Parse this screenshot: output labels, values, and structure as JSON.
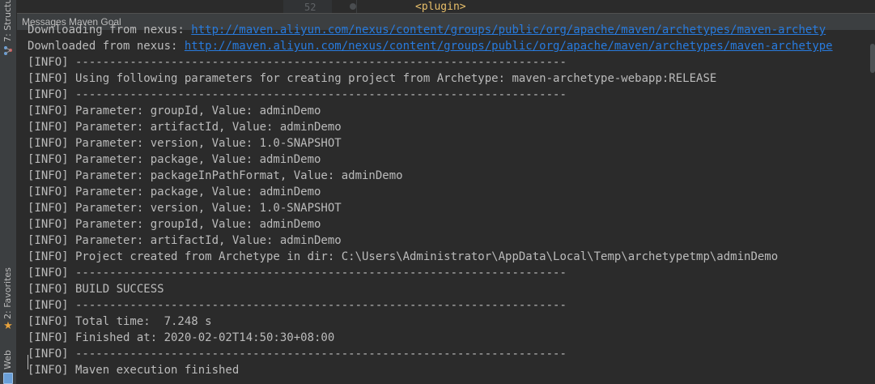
{
  "tool_stripe": {
    "structure_label": "7: Structure",
    "structure_icon": "structure-icon",
    "favorites_label": "2: Favorites",
    "favorites_icon": "star-icon",
    "web_label": "Web",
    "web_icon": "web-icon"
  },
  "editor": {
    "line_number": "52",
    "visible_code": "<plugin>"
  },
  "panel": {
    "title": "Messages Maven Goal"
  },
  "console": {
    "lines": [
      {
        "prefix": "Downloading from nexus: ",
        "link": "http://maven.aliyun.com/nexus/content/groups/public/org/apache/maven/archetypes/maven-archety"
      },
      {
        "prefix": "Downloaded from nexus: ",
        "link": "http://maven.aliyun.com/nexus/content/groups/public/org/apache/maven/archetypes/maven-archetype"
      },
      {
        "text": "[INFO] ------------------------------------------------------------------------"
      },
      {
        "text": "[INFO] Using following parameters for creating project from Archetype: maven-archetype-webapp:RELEASE"
      },
      {
        "text": "[INFO] ------------------------------------------------------------------------"
      },
      {
        "text": "[INFO] Parameter: groupId, Value: adminDemo"
      },
      {
        "text": "[INFO] Parameter: artifactId, Value: adminDemo"
      },
      {
        "text": "[INFO] Parameter: version, Value: 1.0-SNAPSHOT"
      },
      {
        "text": "[INFO] Parameter: package, Value: adminDemo"
      },
      {
        "text": "[INFO] Parameter: packageInPathFormat, Value: adminDemo"
      },
      {
        "text": "[INFO] Parameter: package, Value: adminDemo"
      },
      {
        "text": "[INFO] Parameter: version, Value: 1.0-SNAPSHOT"
      },
      {
        "text": "[INFO] Parameter: groupId, Value: adminDemo"
      },
      {
        "text": "[INFO] Parameter: artifactId, Value: adminDemo"
      },
      {
        "text": "[INFO] Project created from Archetype in dir: C:\\Users\\Administrator\\AppData\\Local\\Temp\\archetypetmp\\adminDemo"
      },
      {
        "text": "[INFO] ------------------------------------------------------------------------"
      },
      {
        "text": "[INFO] BUILD SUCCESS"
      },
      {
        "text": "[INFO] ------------------------------------------------------------------------"
      },
      {
        "text": "[INFO] Total time:  7.248 s"
      },
      {
        "text": "[INFO] Finished at: 2020-02-02T14:50:30+08:00"
      },
      {
        "text": "[INFO] ------------------------------------------------------------------------"
      },
      {
        "text": "[INFO] Maven execution finished"
      }
    ]
  }
}
